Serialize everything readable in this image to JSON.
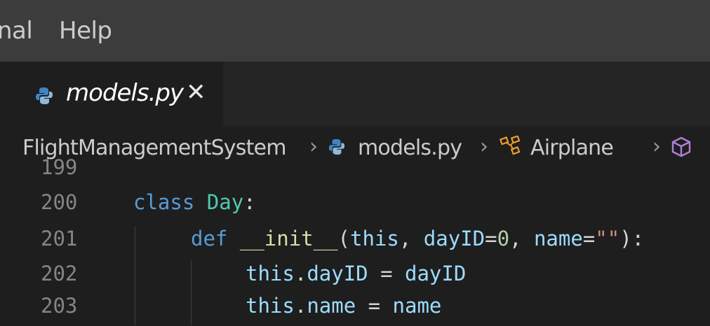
{
  "menubar": {
    "items": [
      {
        "label": "nal"
      },
      {
        "label": "Help"
      }
    ]
  },
  "tab": {
    "label": "models.py",
    "close_glyph": "✕",
    "icon": "python-file-icon"
  },
  "breadcrumb": {
    "items": [
      {
        "label": "FlightManagementSystem"
      },
      {
        "label": "models.py",
        "icon": "python-file-icon"
      },
      {
        "label": "Airplane",
        "icon": "class-icon"
      },
      {
        "label": "",
        "icon": "method-cube-icon"
      }
    ],
    "separator": "›"
  },
  "editor": {
    "lines": [
      {
        "number": "199",
        "code": ""
      },
      {
        "number": "200",
        "code": "class Day:"
      },
      {
        "number": "201",
        "code": "def __init__(this, dayID=0, name=\"\"):"
      },
      {
        "number": "202",
        "code": "this.dayID = dayID"
      },
      {
        "number": "203",
        "code": "this.name = name"
      }
    ]
  },
  "colors": {
    "keyword": "#569cd6",
    "class_name": "#4ec9b0",
    "function": "#dcdcaa",
    "parameter": "#9cdcfe",
    "number": "#b5cea8",
    "string": "#ce9178",
    "line_number": "#858585"
  }
}
